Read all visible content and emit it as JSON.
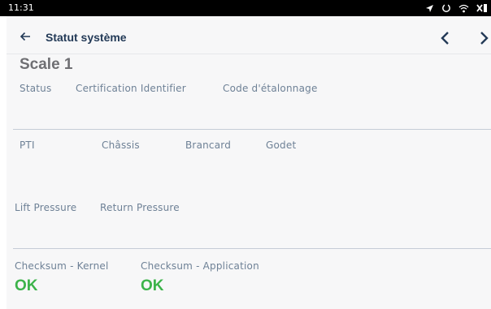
{
  "status_bar": {
    "time": "11:31",
    "icons": [
      "navigation-arrow-icon",
      "sync-ring-icon",
      "wifi-icon",
      "battery-icon"
    ]
  },
  "header": {
    "title": "Statut système",
    "back_icon": "arrow-left-icon",
    "prev_icon": "chevron-left-icon",
    "next_icon": "chevron-right-icon"
  },
  "scale": {
    "name": "Scale 1"
  },
  "section1": {
    "labels": [
      "Status",
      "Certification Identifier",
      "Code d'étalonnage"
    ]
  },
  "section2": {
    "labels": [
      "PTI",
      "Châssis",
      "Brancard",
      "Godet"
    ]
  },
  "section3": {
    "labels": [
      "Lift Pressure",
      "Return Pressure"
    ]
  },
  "section4": {
    "checksum_kernel_label": "Checksum - Kernel",
    "checksum_kernel_value": "OK",
    "checksum_application_label": "Checksum - Application",
    "checksum_application_value": "OK"
  },
  "colors": {
    "header_text": "#233a57",
    "label_text": "#6e8196",
    "ok_green": "#3cb34a",
    "scale_title": "#6f6f73",
    "background": "#f7f7f8"
  }
}
